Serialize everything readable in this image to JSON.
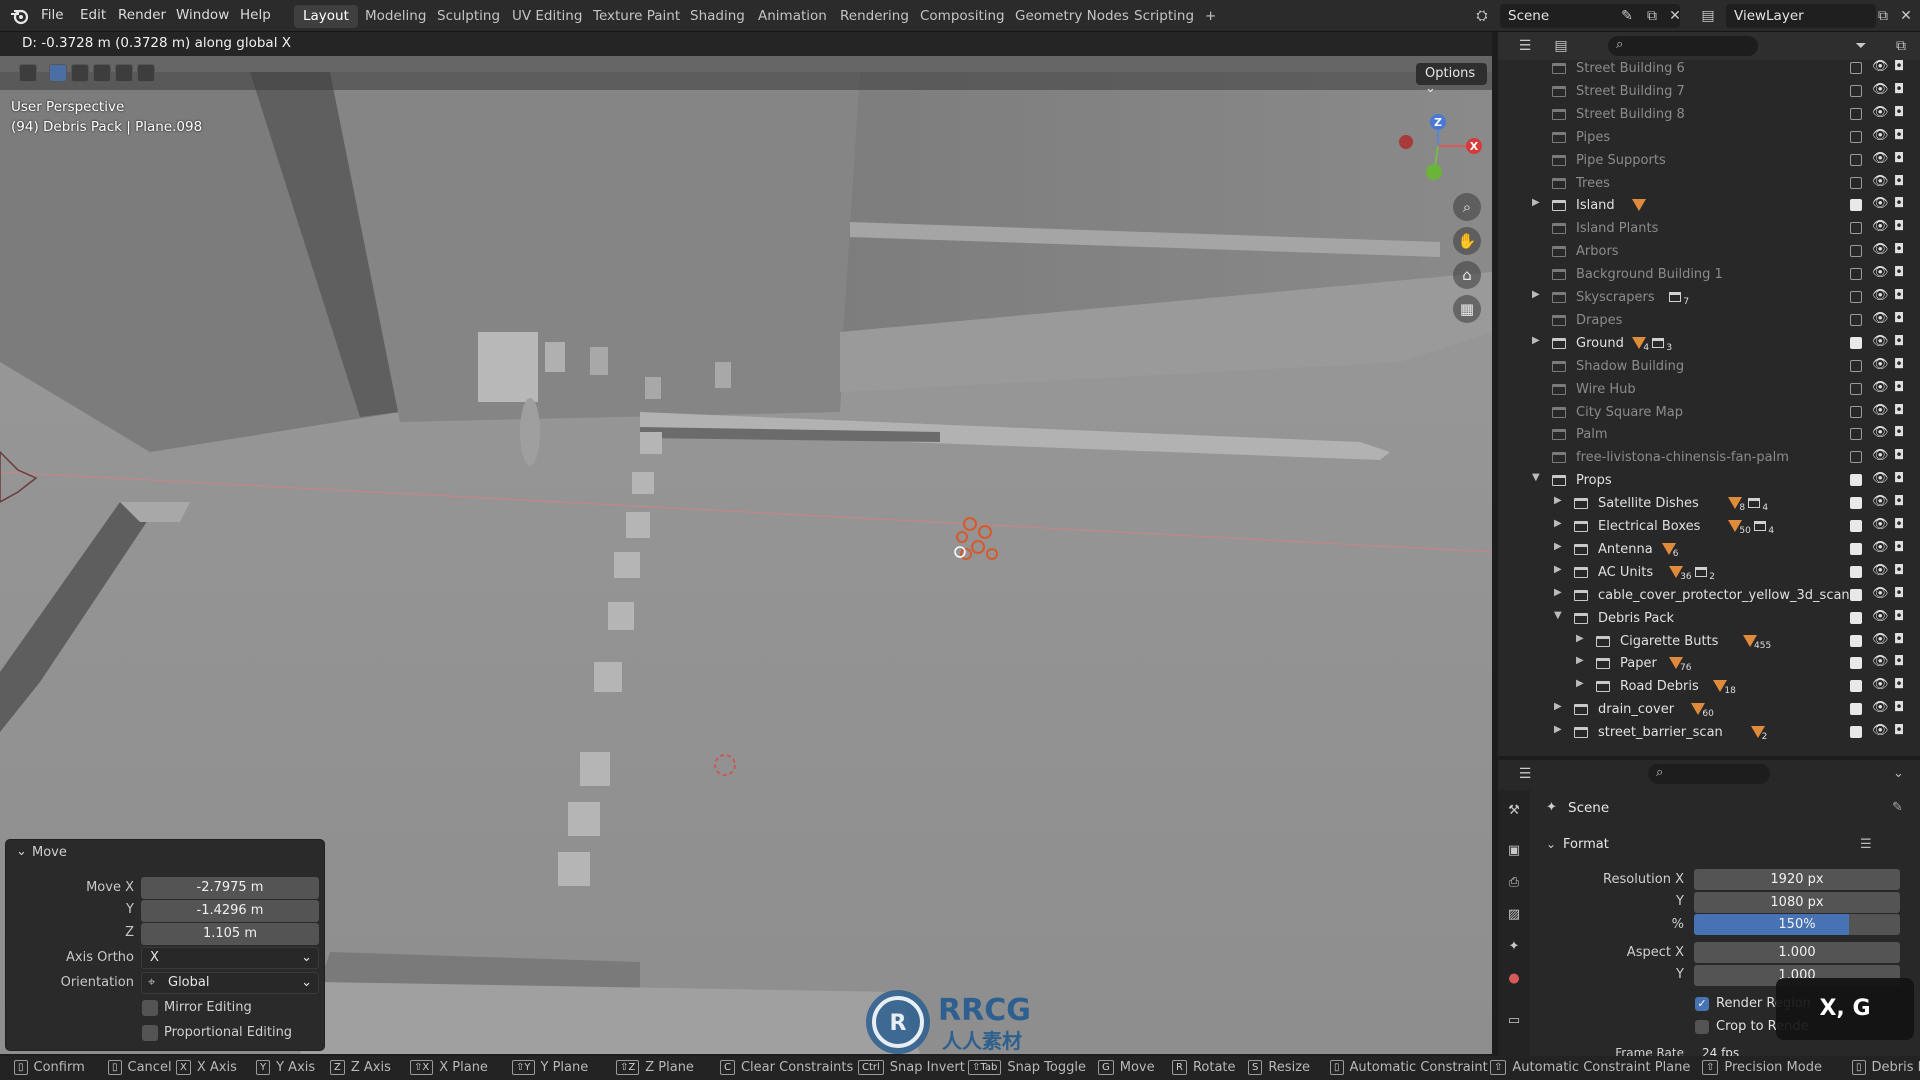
{
  "menu": [
    "File",
    "Edit",
    "Render",
    "Window",
    "Help"
  ],
  "workspaces": [
    "Layout",
    "Modeling",
    "Sculpting",
    "UV Editing",
    "Texture Paint",
    "Shading",
    "Animation",
    "Rendering",
    "Compositing",
    "Geometry Nodes",
    "Scripting",
    "+"
  ],
  "scene_name": "Scene",
  "view_layer": "ViewLayer",
  "viewport": {
    "header_text": "D: -0.3728 m (0.3728 m) along global X",
    "options_label": "Options",
    "perspective": "User Perspective",
    "active_object": "(94) Debris Pack | Plane.098",
    "gizmo": {
      "z": "Z",
      "x": "X"
    }
  },
  "move_panel": {
    "title": "Move",
    "move_x_label": "Move X",
    "move_x": "-2.7975 m",
    "y_label": "Y",
    "move_y": "-1.4296 m",
    "z_label": "Z",
    "move_z": "1.105 m",
    "axis_ortho_label": "Axis Ortho",
    "axis_ortho": "X",
    "orientation_label": "Orientation",
    "orientation": "Global",
    "mirror_editing": "Mirror Editing",
    "proportional_editing": "Proportional Editing"
  },
  "outliner": [
    {
      "name": "Street Building 6",
      "indent": 0,
      "enabled": false
    },
    {
      "name": "Street Building 7",
      "indent": 0,
      "enabled": false
    },
    {
      "name": "Street Building 8",
      "indent": 0,
      "enabled": false
    },
    {
      "name": "Pipes",
      "indent": 0,
      "enabled": false
    },
    {
      "name": "Pipe Supports",
      "indent": 0,
      "enabled": false
    },
    {
      "name": "Trees",
      "indent": 0,
      "enabled": false
    },
    {
      "name": "Island",
      "indent": 0,
      "enabled": true,
      "expand": "right",
      "badge_mesh": ""
    },
    {
      "name": "Island Plants",
      "indent": 0,
      "enabled": false
    },
    {
      "name": "Arbors",
      "indent": 0,
      "enabled": false
    },
    {
      "name": "Background Building 1",
      "indent": 0,
      "enabled": false
    },
    {
      "name": "Skyscrapers",
      "indent": 0,
      "enabled": false,
      "expand": "right",
      "badge_coll": "7"
    },
    {
      "name": "Drapes",
      "indent": 0,
      "enabled": false
    },
    {
      "name": "Ground",
      "indent": 0,
      "enabled": true,
      "expand": "right",
      "badge_mesh": "4",
      "badge_coll": "3"
    },
    {
      "name": "Shadow Building",
      "indent": 0,
      "enabled": false
    },
    {
      "name": "Wire Hub",
      "indent": 0,
      "enabled": false
    },
    {
      "name": "City Square Map",
      "indent": 0,
      "enabled": false
    },
    {
      "name": "Palm",
      "indent": 0,
      "enabled": false
    },
    {
      "name": "free-livistona-chinensis-fan-palm",
      "indent": 0,
      "enabled": false
    },
    {
      "name": "Props",
      "indent": 0,
      "enabled": true,
      "expand": "down"
    },
    {
      "name": "Satellite Dishes",
      "indent": 1,
      "enabled": true,
      "expand": "right",
      "badge_mesh": "8",
      "badge_coll": "4"
    },
    {
      "name": "Electrical Boxes",
      "indent": 1,
      "enabled": true,
      "expand": "right",
      "badge_mesh": "50",
      "badge_coll": "4"
    },
    {
      "name": "Antenna",
      "indent": 1,
      "enabled": true,
      "expand": "right",
      "badge_mesh": "6"
    },
    {
      "name": "AC Units",
      "indent": 1,
      "enabled": true,
      "expand": "right",
      "badge_mesh": "36",
      "badge_coll": "2"
    },
    {
      "name": "cable_cover_protector_yellow_3d_scan",
      "indent": 1,
      "enabled": true,
      "expand": "right"
    },
    {
      "name": "Debris Pack",
      "indent": 1,
      "enabled": true,
      "expand": "down"
    },
    {
      "name": "Cigarette Butts",
      "indent": 2,
      "enabled": true,
      "expand": "right",
      "badge_mesh": "455"
    },
    {
      "name": "Paper",
      "indent": 2,
      "enabled": true,
      "expand": "right",
      "badge_mesh": "76"
    },
    {
      "name": "Road Debris",
      "indent": 2,
      "enabled": true,
      "expand": "right",
      "badge_mesh": "18"
    },
    {
      "name": "drain_cover",
      "indent": 1,
      "enabled": true,
      "expand": "right",
      "badge_mesh": "60"
    },
    {
      "name": "street_barrier_scan",
      "indent": 1,
      "enabled": true,
      "expand": "right",
      "badge_mesh": "2"
    }
  ],
  "properties": {
    "context": "Scene",
    "section": "Format",
    "resolution_x_label": "Resolution X",
    "resolution_x": "1920 px",
    "y_label": "Y",
    "resolution_y": "1080 px",
    "percent_label": "%",
    "percent": "150%",
    "percent_fill": 0.75,
    "aspect_x_label": "Aspect X",
    "aspect_x": "1.000",
    "aspect_y_label": "Y",
    "aspect_y": "1.000",
    "render_region": "Render Region",
    "crop_to_render": "Crop to Rende",
    "frame_rate_label": "Frame Rate",
    "frame_rate": "24 fps"
  },
  "shortcut_overlay": "X, G",
  "watermark": {
    "line1": "RRCG",
    "line2": "人人素材"
  },
  "status_bar": [
    {
      "key": "",
      "label": "Confirm"
    },
    {
      "key": "",
      "label": "Cancel"
    },
    {
      "key": "X",
      "label": "X Axis"
    },
    {
      "key": "Y",
      "label": "Y Axis"
    },
    {
      "key": "Z",
      "label": "Z Axis"
    },
    {
      "key": "⇧X",
      "label": "X Plane"
    },
    {
      "key": "⇧Y",
      "label": "Y Plane"
    },
    {
      "key": "⇧Z",
      "label": "Z Plane"
    },
    {
      "key": "C",
      "label": "Clear Constraints"
    },
    {
      "key": "Ctrl",
      "label": "Snap Invert"
    },
    {
      "key": "⇧Tab",
      "label": "Snap Toggle"
    },
    {
      "key": "G",
      "label": "Move"
    },
    {
      "key": "R",
      "label": "Rotate"
    },
    {
      "key": "S",
      "label": "Resize"
    },
    {
      "key": "",
      "label": "Automatic Constraint"
    },
    {
      "key": "⇧",
      "label": "Automatic Constraint Plane"
    },
    {
      "key": "⇧",
      "label": "Precision Mode"
    },
    {
      "key": "",
      "label": "Debris Pac"
    }
  ]
}
